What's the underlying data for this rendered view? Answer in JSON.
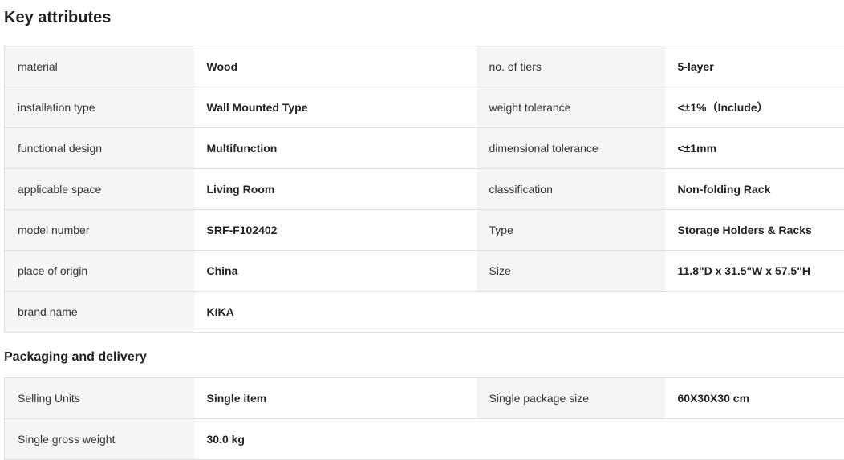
{
  "key_attributes": {
    "title": "Key attributes",
    "rows": [
      {
        "l1": "material",
        "v1": "Wood",
        "l2": "no. of tiers",
        "v2": "5-layer"
      },
      {
        "l1": "installation type",
        "v1": "Wall Mounted Type",
        "l2": "weight tolerance",
        "v2": "<±1%（Include）"
      },
      {
        "l1": "functional design",
        "v1": "Multifunction",
        "l2": "dimensional tolerance",
        "v2": "<±1mm"
      },
      {
        "l1": "applicable space",
        "v1": "Living Room",
        "l2": "classification",
        "v2": "Non-folding Rack"
      },
      {
        "l1": "model number",
        "v1": "SRF-F102402",
        "l2": "Type",
        "v2": "Storage Holders & Racks"
      },
      {
        "l1": "place of origin",
        "v1": "China",
        "l2": "Size",
        "v2": "11.8\"D x 31.5\"W x 57.5\"H"
      },
      {
        "l1": "brand name",
        "v1": "KIKA",
        "l2": "",
        "v2": ""
      }
    ]
  },
  "packaging": {
    "title": "Packaging and delivery",
    "rows": [
      {
        "l1": "Selling Units",
        "v1": "Single item",
        "l2": "Single package size",
        "v2": "60X30X30 cm"
      },
      {
        "l1": "Single gross weight",
        "v1": "30.0 kg",
        "l2": "",
        "v2": ""
      }
    ]
  }
}
